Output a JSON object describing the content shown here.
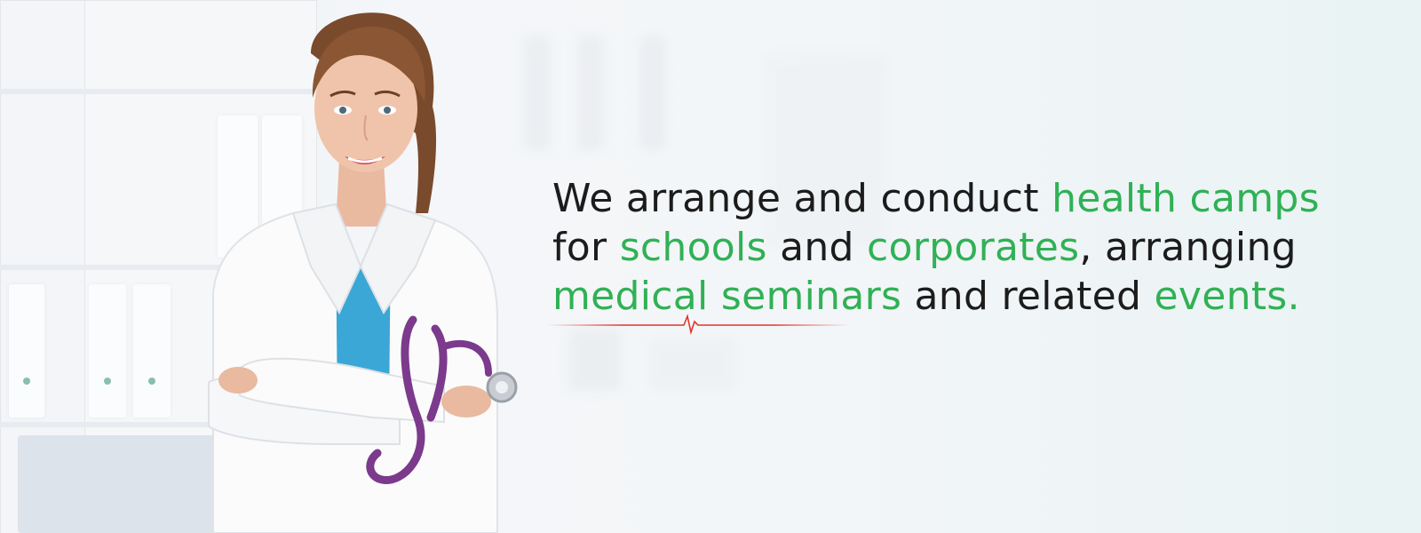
{
  "banner": {
    "headline": {
      "line1": {
        "t1": "We arrange and conduct ",
        "h1": "health camps"
      },
      "line2": {
        "t1": "for ",
        "h1": "schools",
        "t2": " and ",
        "h2": "corporates",
        "t3": ", arranging"
      },
      "line3": {
        "h1": "medical seminars",
        "t1": " and related ",
        "h2": "events."
      }
    },
    "colors": {
      "highlight": "#30b155",
      "text": "#1c1c1c",
      "pulse": "#e0342c"
    },
    "image": {
      "subject": "female doctor with stethoscope",
      "icon": "doctor-photo-icon"
    }
  }
}
